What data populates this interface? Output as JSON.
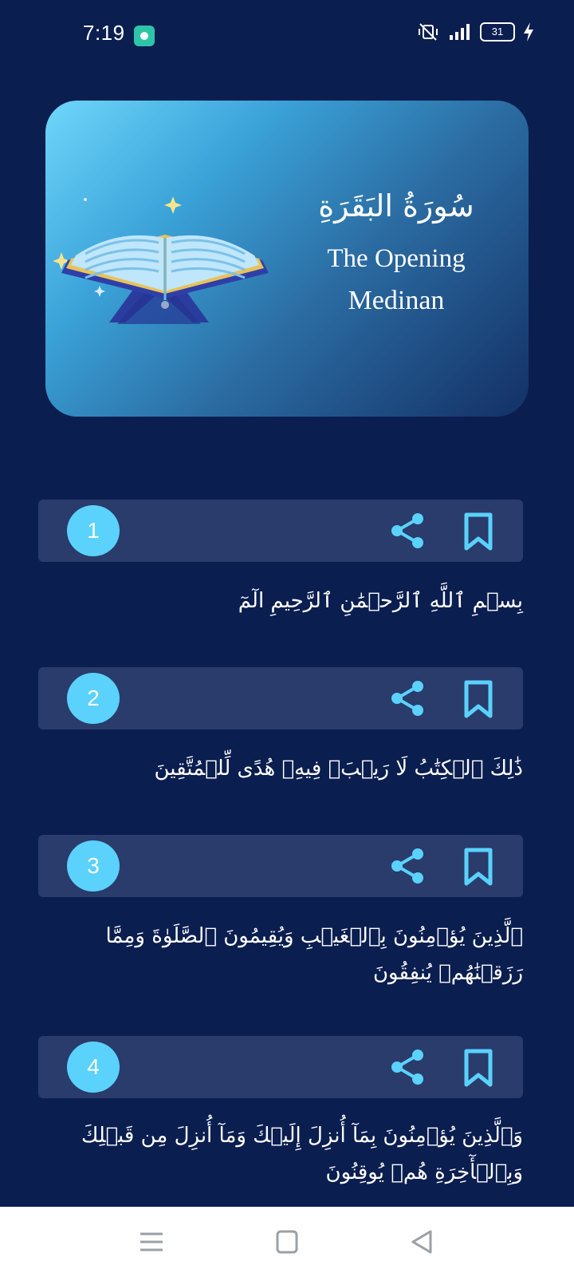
{
  "status_bar": {
    "time": "7:19",
    "battery": "31"
  },
  "header": {
    "surah_arabic": "سُورَةُ البَقَرَةِ",
    "surah_english": "The Opening",
    "surah_type": "Medinan"
  },
  "ayahs": [
    {
      "number": "1",
      "text": "بِسۡمِ ٱللَّهِ ٱلرَّحۡمَٰنِ ٱلرَّحِيمِ الٓمٓ"
    },
    {
      "number": "2",
      "text": "ذَٰلِكَ ٱلۡكِتَٰبُ لَا رَيۡبَۛ فِيهِۛ هُدًى لِّلۡمُتَّقِينَ"
    },
    {
      "number": "3",
      "text": "ٱلَّذِينَ يُؤۡمِنُونَ بِٱلۡغَيۡبِ وَيُقِيمُونَ ٱلصَّلَوٰةَ وَمِمَّا رَزَقۡنَٰهُمۡ يُنفِقُونَ"
    },
    {
      "number": "4",
      "text": "وَٱلَّذِينَ يُؤۡمِنُونَ بِمَآ أُنزِلَ إِلَيۡكَ وَمَآ أُنزِلَ مِن قَبۡلِكَ وَبِٱلۡأٓخِرَةِ هُمۡ يُوقِنُونَ"
    }
  ],
  "colors": {
    "background": "#0b1e50",
    "ayah_bar": "#2a3c6c",
    "accent": "#5ad2fb"
  },
  "icons": {
    "share": "share-icon",
    "bookmark": "bookmark-icon",
    "nav_menu": "menu-icon",
    "nav_home": "home-icon",
    "nav_back": "back-icon"
  }
}
